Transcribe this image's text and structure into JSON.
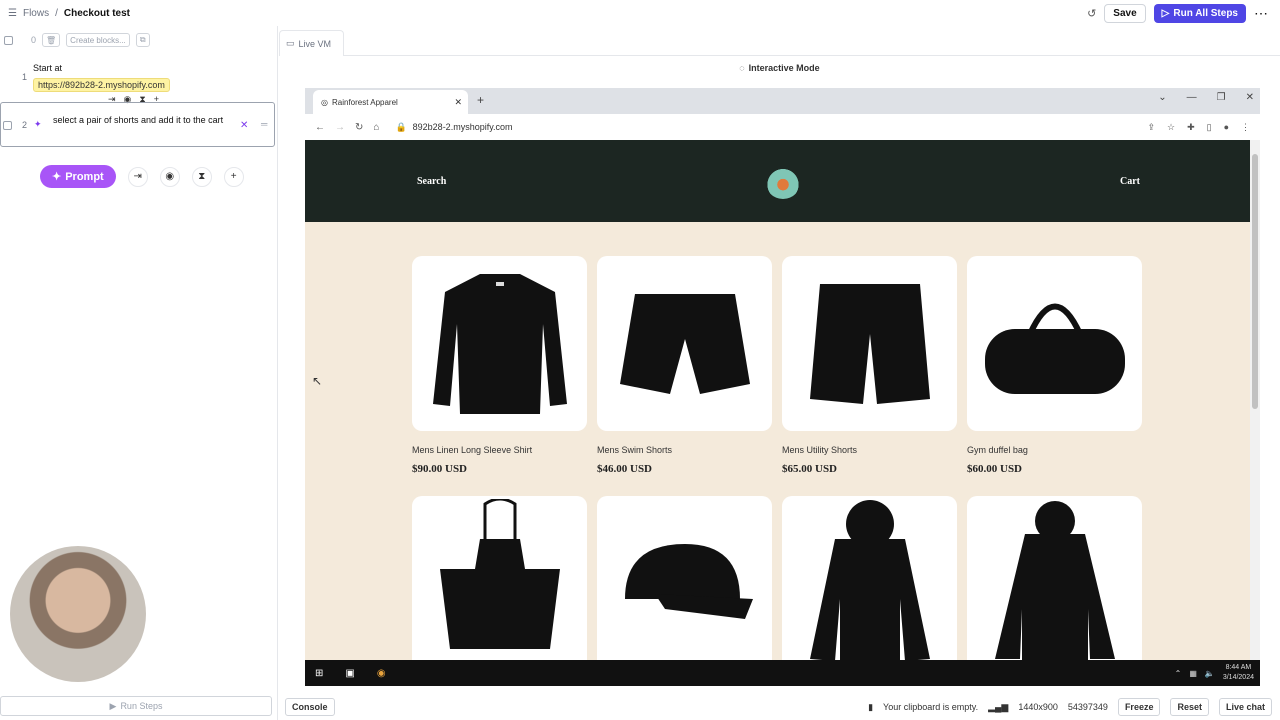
{
  "breadcrumb": {
    "root": "Flows",
    "separator": "/",
    "current": "Checkout test"
  },
  "top_actions": {
    "save": "Save",
    "run_all": "Run All Steps"
  },
  "left_panel": {
    "toolbar": {
      "count": "0",
      "create_blocks": "Create blocks..."
    },
    "steps": [
      {
        "number": "1",
        "title": "Start at",
        "url": "https://892b28-2.myshopify.com"
      },
      {
        "number": "2",
        "text": "select a pair of shorts and add it to the cart"
      }
    ],
    "prompt_button": "Prompt",
    "run_steps": "Run Steps"
  },
  "main_panel": {
    "tab_label": "Live VM",
    "mode_label": "Interactive Mode"
  },
  "browser": {
    "tab_title": "Rainforest Apparel",
    "address": "892b28-2.myshopify.com"
  },
  "site": {
    "nav_left": "Search",
    "nav_right": "Cart",
    "products": [
      {
        "name": "Mens Linen Long Sleeve Shirt",
        "price": "$90.00 USD",
        "icon": "shirt"
      },
      {
        "name": "Mens Swim Shorts",
        "price": "$46.00 USD",
        "icon": "shorts"
      },
      {
        "name": "Mens Utility Shorts",
        "price": "$65.00 USD",
        "icon": "shorts-long"
      },
      {
        "name": "Gym duffel bag",
        "price": "$60.00 USD",
        "icon": "bag"
      },
      {
        "name": "",
        "price": "",
        "icon": "apron"
      },
      {
        "name": "",
        "price": "",
        "icon": "cap"
      },
      {
        "name": "",
        "price": "",
        "icon": "hoodie"
      },
      {
        "name": "",
        "price": "",
        "icon": "jacket"
      }
    ]
  },
  "taskbar": {
    "time": "8:44 AM",
    "date": "3/14/2024"
  },
  "bottom_bar": {
    "console": "Console",
    "clipboard": "Your clipboard is empty.",
    "resolution": "1440x900",
    "session_id": "54397349",
    "freeze": "Freeze",
    "reset": "Reset",
    "live_chat": "Live chat"
  },
  "colors": {
    "accent": "#4f46e5",
    "prompt": "#a855f7",
    "site_header": "#1c2622",
    "site_bg": "#f4eadb"
  }
}
